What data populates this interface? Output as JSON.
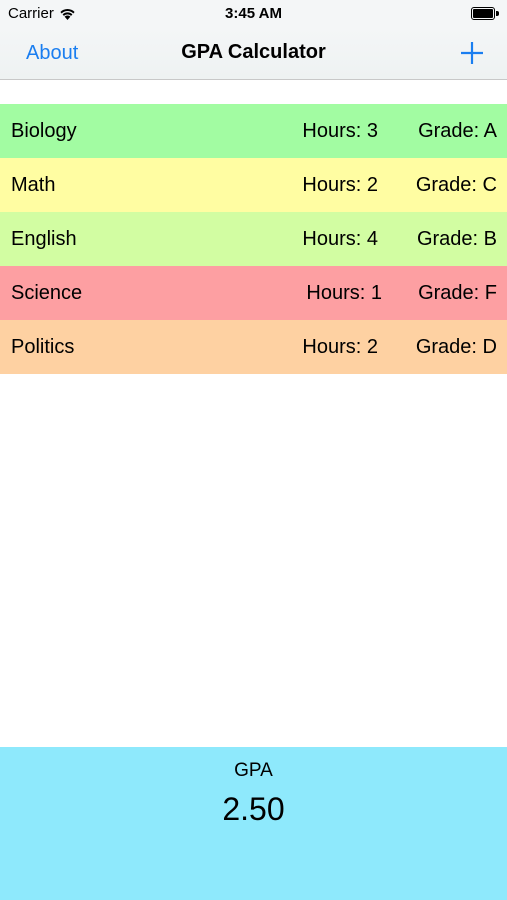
{
  "status_bar": {
    "carrier": "Carrier",
    "time": "3:45 AM",
    "wifi_icon": "wifi-icon",
    "battery_icon": "battery-icon"
  },
  "nav": {
    "about_label": "About",
    "title": "GPA Calculator",
    "add_icon": "plus-icon",
    "accent_color": "#1a7ef0"
  },
  "courses": [
    {
      "name": "Biology",
      "hours": "Hours: 3",
      "grade": "Grade: A",
      "color": "#a2fca2"
    },
    {
      "name": "Math",
      "hours": "Hours: 2",
      "grade": "Grade: C",
      "color": "#fffda2"
    },
    {
      "name": "English",
      "hours": "Hours: 4",
      "grade": "Grade: B",
      "color": "#d2fda2"
    },
    {
      "name": "Science",
      "hours": "Hours: 1",
      "grade": "Grade: F",
      "color": "#fd9fa2"
    },
    {
      "name": "Politics",
      "hours": "Hours: 2",
      "grade": "Grade: D",
      "color": "#fed1a2"
    }
  ],
  "gpa": {
    "label": "GPA",
    "value": "2.50",
    "panel_color": "#8ee9fc"
  }
}
